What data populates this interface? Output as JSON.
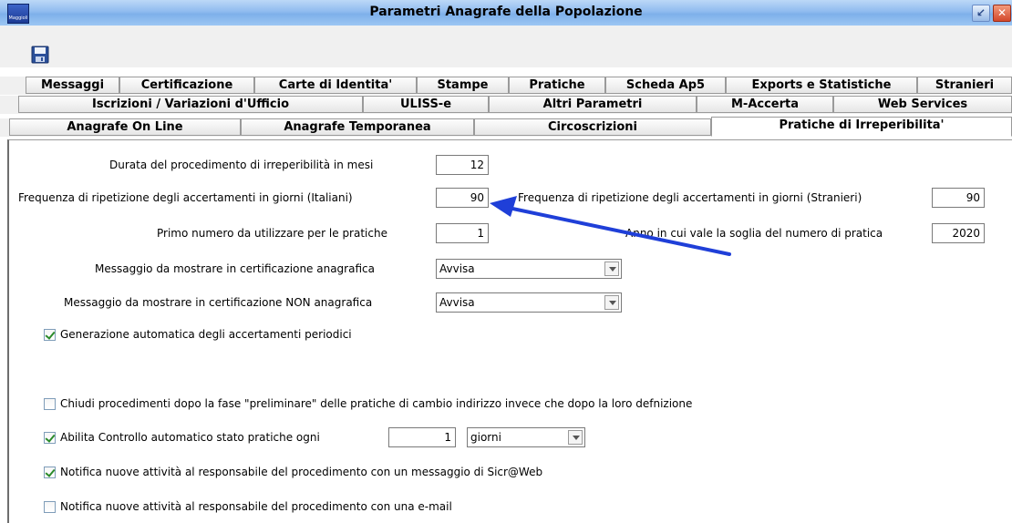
{
  "window": {
    "title": "Parametri Anagrafe della Popolazione",
    "icon_caption": "Maggioli",
    "restore_glyph": "↙",
    "close_glyph": "✕"
  },
  "toolbar": {
    "save_icon": "floppy-disk-icon"
  },
  "tabs": {
    "row1": [
      "Messaggi",
      "Certificazione",
      "Carte di Identita'",
      "Stampe",
      "Pratiche",
      "Scheda Ap5",
      "Exports e Statistiche",
      "Stranieri"
    ],
    "row2": [
      "Iscrizioni / Variazioni d'Ufficio",
      "ULISS-e",
      "Altri Parametri",
      "M-Accerta",
      "Web Services"
    ],
    "row3": [
      "Anagrafe On Line",
      "Anagrafe Temporanea",
      "Circoscrizioni",
      "Pratiche di Irreperibilita'"
    ],
    "active": "Pratiche di Irreperibilita'"
  },
  "form": {
    "durata": {
      "label": "Durata del procedimento di irreperibilità in mesi",
      "value": "12"
    },
    "freq_italiani": {
      "label": "Frequenza di ripetizione degli accertamenti in giorni (Italiani)",
      "value": "90"
    },
    "freq_stranieri": {
      "label": "Frequenza di ripetizione degli accertamenti in giorni (Stranieri)",
      "value": "90"
    },
    "primo_numero": {
      "label": "Primo numero da utilizzare per le pratiche",
      "value": "1"
    },
    "anno_soglia": {
      "label": "Anno in cui vale la soglia del numero di pratica",
      "value": "2020"
    },
    "msg_anagrafica": {
      "label": "Messaggio da mostrare in certificazione anagrafica",
      "value": "Avvisa"
    },
    "msg_non_anagrafica": {
      "label": "Messaggio da mostrare in certificazione NON anagrafica",
      "value": "Avvisa"
    },
    "generazione_auto": {
      "label": "Generazione automatica degli accertamenti periodici",
      "checked": true
    },
    "chiudi_procedimenti": {
      "label": "Chiudi procedimenti dopo la fase \"preliminare\" delle pratiche di cambio indirizzo invece che dopo la loro defnizione",
      "checked": false
    },
    "controllo_auto": {
      "label": "Abilita Controllo automatico stato pratiche ogni",
      "checked": true,
      "value": "1",
      "unit": "giorni"
    },
    "notifica_messaggio": {
      "label": "Notifica nuove attività al responsabile del procedimento con un messaggio di Sicr@Web",
      "checked": true
    },
    "notifica_email": {
      "label": "Notifica nuove attività al responsabile del procedimento con una e-mail",
      "checked": false
    }
  },
  "annotation": {
    "arrow_color": "#1f3fd8"
  },
  "colors": {
    "titlebar": "#90bbef",
    "panel_bg": "#ffffff",
    "tab_bg": "#f0f0f0"
  }
}
